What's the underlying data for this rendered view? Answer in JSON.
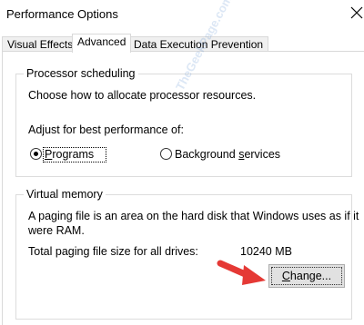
{
  "window": {
    "title": "Performance Options"
  },
  "tabs": [
    {
      "label": "Visual Effects"
    },
    {
      "label": "Advanced"
    },
    {
      "label": "Data Execution Prevention"
    }
  ],
  "processor": {
    "legend": "Processor scheduling",
    "description": "Choose how to allocate processor resources.",
    "adjust_label": "Adjust for best performance of:",
    "options": [
      {
        "label_pre": "",
        "label_u": "P",
        "label_post": "rograms",
        "selected": true
      },
      {
        "label_pre": "Background ",
        "label_u": "s",
        "label_post": "ervices",
        "selected": false
      }
    ]
  },
  "virtual_memory": {
    "legend": "Virtual memory",
    "description_line1": "A paging file is an area on the hard disk that Windows uses as if it",
    "description_line2": "were RAM.",
    "total_label": "Total paging file size for all drives:",
    "total_value": "10240 MB",
    "change_button_pre": "",
    "change_button_u": "C",
    "change_button_post": "hange..."
  },
  "watermark": "TheGeekPage.com",
  "colors": {
    "arrow": "#e53935",
    "button_bg": "#e1e1e1",
    "tab_inactive": "#f0f0f0"
  }
}
